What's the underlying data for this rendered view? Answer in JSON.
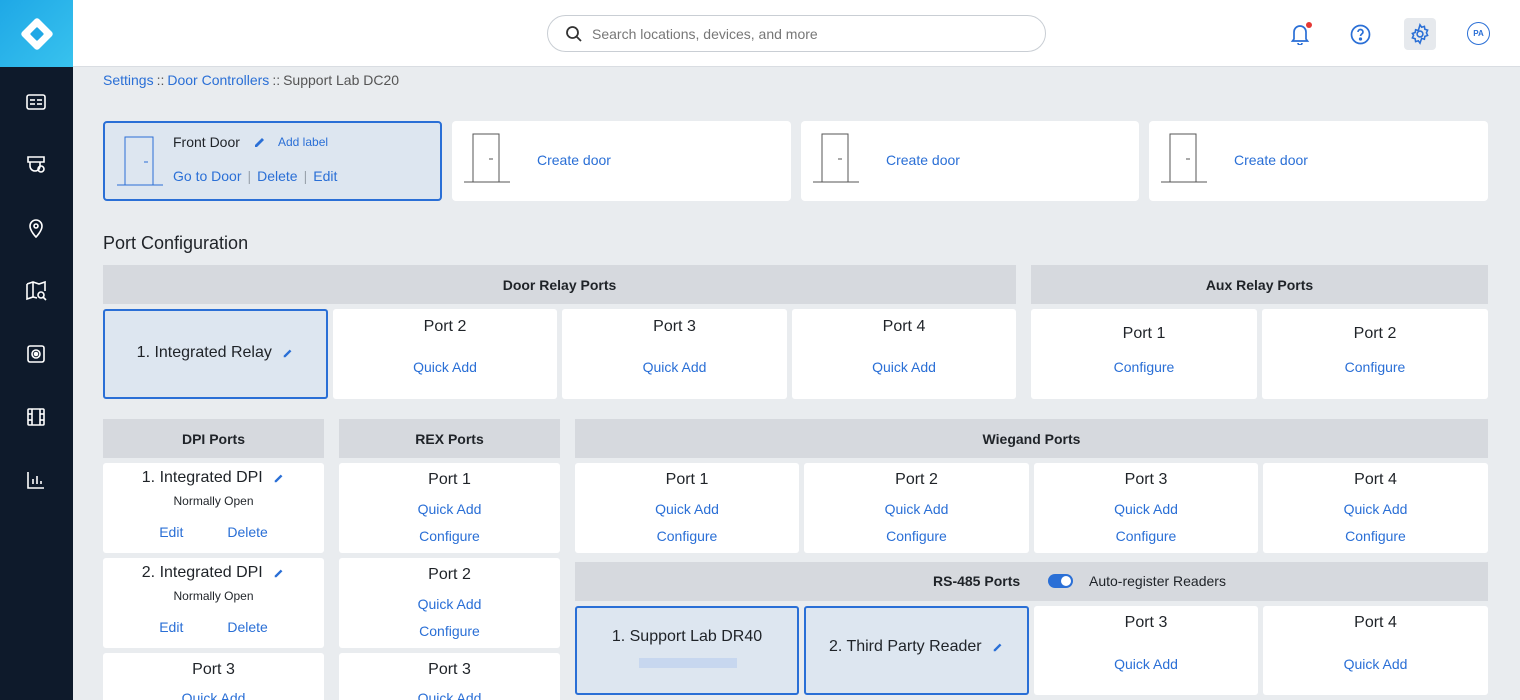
{
  "search": {
    "placeholder": "Search locations, devices, and more"
  },
  "user": {
    "initials": "PA"
  },
  "breadcrumb": {
    "items": [
      "Settings",
      "Door Controllers",
      "Support Lab DC20"
    ],
    "separator": "::"
  },
  "doors": {
    "front": {
      "name": "Front Door",
      "add_label": "Add label",
      "go_to": "Go to Door",
      "delete": "Delete",
      "edit": "Edit",
      "divider": "|"
    },
    "create_label": "Create door"
  },
  "port_config": {
    "title": "Port Configuration",
    "door_relay": {
      "header": "Door Relay Ports",
      "ports": [
        {
          "title": "1. Integrated Relay"
        },
        {
          "title": "Port 2",
          "action": "Quick Add"
        },
        {
          "title": "Port 3",
          "action": "Quick Add"
        },
        {
          "title": "Port 4",
          "action": "Quick Add"
        }
      ]
    },
    "aux_relay": {
      "header": "Aux Relay Ports",
      "ports": [
        {
          "title": "Port 1",
          "action": "Configure"
        },
        {
          "title": "Port 2",
          "action": "Configure"
        }
      ]
    },
    "dpi": {
      "header": "DPI Ports",
      "ports": [
        {
          "title": "1. Integrated DPI",
          "status": "Normally Open",
          "edit": "Edit",
          "delete": "Delete"
        },
        {
          "title": "2. Integrated DPI",
          "status": "Normally Open",
          "edit": "Edit",
          "delete": "Delete"
        },
        {
          "title": "Port 3",
          "action": "Quick Add"
        }
      ]
    },
    "rex": {
      "header": "REX Ports",
      "ports": [
        {
          "title": "Port 1",
          "quick_add": "Quick Add",
          "configure": "Configure"
        },
        {
          "title": "Port 2",
          "quick_add": "Quick Add",
          "configure": "Configure"
        },
        {
          "title": "Port 3",
          "quick_add": "Quick Add"
        }
      ]
    },
    "wiegand": {
      "header": "Wiegand Ports",
      "ports": [
        {
          "title": "Port 1",
          "quick_add": "Quick Add",
          "configure": "Configure"
        },
        {
          "title": "Port 2",
          "quick_add": "Quick Add",
          "configure": "Configure"
        },
        {
          "title": "Port 3",
          "quick_add": "Quick Add",
          "configure": "Configure"
        },
        {
          "title": "Port 4",
          "quick_add": "Quick Add",
          "configure": "Configure"
        }
      ]
    },
    "rs485": {
      "header": "RS-485 Ports",
      "auto_register_label": "Auto-register Readers",
      "auto_register_on": true,
      "ports": [
        {
          "title": "1. Support Lab DR40"
        },
        {
          "title": "2. Third Party Reader"
        },
        {
          "title": "Port 3",
          "action": "Quick Add"
        },
        {
          "title": "Port 4",
          "action": "Quick Add"
        }
      ]
    }
  },
  "colors": {
    "accent": "#2a6fd6",
    "sidebar": "#0e1a2b",
    "logo": "#1fa8e6",
    "selected_bg": "#dde6f0",
    "header_bg": "#d6d9de"
  }
}
